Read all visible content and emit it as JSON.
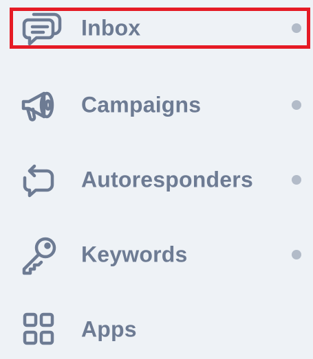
{
  "sidebar": {
    "items": [
      {
        "label": "Inbox",
        "icon": "chat-bubbles-icon",
        "active": true,
        "has_dot": true
      },
      {
        "label": "Campaigns",
        "icon": "megaphone-icon",
        "active": false,
        "has_dot": true
      },
      {
        "label": "Autoresponders",
        "icon": "reply-arrow-icon",
        "active": false,
        "has_dot": true
      },
      {
        "label": "Keywords",
        "icon": "key-icon",
        "active": false,
        "has_dot": true
      },
      {
        "label": "Apps",
        "icon": "grid-icon",
        "active": false,
        "has_dot": false
      }
    ]
  },
  "colors": {
    "background": "#eef2f6",
    "text": "#6d7b93",
    "icon": "#6d7b93",
    "dot": "#b2bbc8",
    "highlight_border": "#e51b25"
  }
}
